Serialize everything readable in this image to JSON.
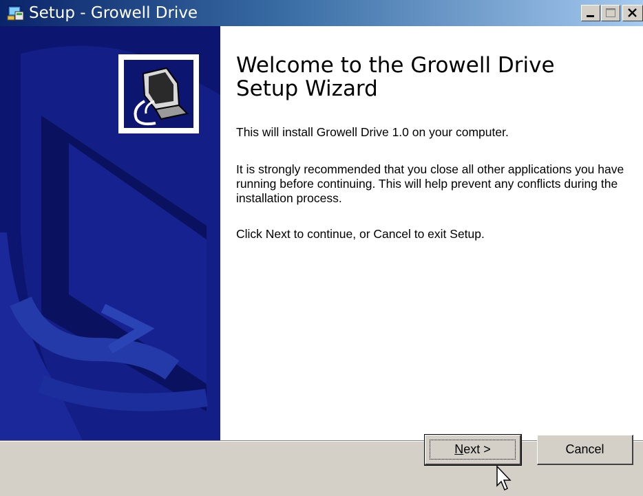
{
  "window": {
    "title": "Setup - Growell Drive",
    "icons": {
      "app": "setup-app-icon",
      "minimize": "minimize-icon",
      "maximize": "maximize-icon",
      "close": "close-icon"
    }
  },
  "sidebar": {
    "logo": "computer-install-icon"
  },
  "content": {
    "heading": "Welcome to the Growell Drive Setup Wizard",
    "paragraphs": [
      "This will install Growell Drive 1.0 on your computer.",
      "It is strongly recommended that you close all other applications you have running before continuing. This will help prevent any conflicts during the installation process.",
      "Click Next to continue, or Cancel to exit Setup."
    ]
  },
  "buttons": {
    "next_mnemonic": "N",
    "next_rest": "ext >",
    "cancel": "Cancel"
  },
  "colors": {
    "sidebar": "#0c1670",
    "titlebar_start": "#0a246a",
    "titlebar_end": "#a6caf0",
    "face": "#d4d0c8"
  }
}
